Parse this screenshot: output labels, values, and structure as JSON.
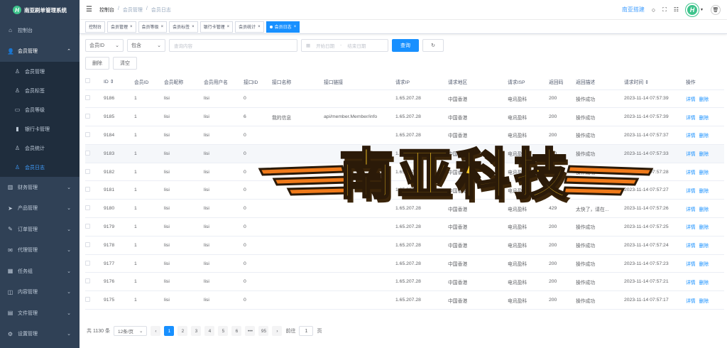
{
  "app": {
    "title": "南亚刷单管理系统"
  },
  "sidebar": {
    "items": [
      {
        "label": "控制台",
        "icon": "home-icon"
      },
      {
        "label": "会员管理",
        "icon": "user-icon"
      }
    ],
    "sub": [
      {
        "label": "会员管理",
        "icon": "user-icon"
      },
      {
        "label": "会员标签",
        "icon": "user-icon"
      },
      {
        "label": "会员等级",
        "icon": "card-icon"
      },
      {
        "label": "银行卡管理",
        "icon": "bank-icon"
      },
      {
        "label": "会员统计",
        "icon": "user-icon"
      },
      {
        "label": "会员日志",
        "icon": "user-icon"
      }
    ],
    "rest": [
      {
        "label": "财务管理",
        "icon": "chart-icon"
      },
      {
        "label": "产品管理",
        "icon": "send-icon"
      },
      {
        "label": "订单管理",
        "icon": "edit-icon"
      },
      {
        "label": "代理管理",
        "icon": "message-icon"
      },
      {
        "label": "任务组",
        "icon": "calendar-icon"
      },
      {
        "label": "内容管理",
        "icon": "content-icon"
      },
      {
        "label": "文件管理",
        "icon": "file-icon"
      },
      {
        "label": "设置管理",
        "icon": "gear-icon"
      }
    ]
  },
  "navbar": {
    "crumbs": [
      "控制台",
      "会员管理",
      "会员日志"
    ],
    "brand": "南亚搭建"
  },
  "tags": [
    "控制台",
    "会员管理",
    "会员等级",
    "会员标签",
    "银行卡管理",
    "会员统计",
    "会员日志"
  ],
  "filters": {
    "field": "会员ID",
    "op": "包含",
    "query_placeholder": "查询内容",
    "start_placeholder": "开始日期",
    "sep": "-",
    "end_placeholder": "结束日期",
    "search": "查询",
    "delete": "删除",
    "clear": "清空"
  },
  "columns": [
    "ID",
    "会员ID",
    "会员昵称",
    "会员用户名",
    "接口ID",
    "接口名称",
    "接口链接",
    "请求IP",
    "请求地区",
    "请求ISP",
    "返回码",
    "返回描述",
    "请求时间",
    "操作"
  ],
  "rows": [
    [
      "9186",
      "1",
      "lisi",
      "lisi",
      "0",
      "",
      "",
      "1.65.207.28",
      "中国香港",
      "电讯盈科",
      "200",
      "操作成功",
      "2023-11-14 07:57:39"
    ],
    [
      "9185",
      "1",
      "lisi",
      "lisi",
      "6",
      "我的信息",
      "api/member.Member/info",
      "1.65.207.28",
      "中国香港",
      "电讯盈科",
      "200",
      "操作成功",
      "2023-11-14 07:57:39"
    ],
    [
      "9184",
      "1",
      "lisi",
      "lisi",
      "0",
      "",
      "",
      "1.65.207.28",
      "中国香港",
      "电讯盈科",
      "200",
      "操作成功",
      "2023-11-14 07:57:37"
    ],
    [
      "9183",
      "1",
      "lisi",
      "lisi",
      "0",
      "",
      "",
      "1.65.207.28",
      "中国香港",
      "电讯盈科",
      "200",
      "操作成功",
      "2023-11-14 07:57:33"
    ],
    [
      "9182",
      "1",
      "lisi",
      "lisi",
      "0",
      "",
      "",
      "1.65.207.28",
      "中国香港",
      "电讯盈科",
      "200",
      "操作成功",
      "2023-11-14 07:57:28"
    ],
    [
      "9181",
      "1",
      "lisi",
      "lisi",
      "0",
      "",
      "",
      "1.65.207.28",
      "中国香港",
      "电讯盈科",
      "200",
      "操作成功",
      "2023-11-14 07:57:27"
    ],
    [
      "9180",
      "1",
      "lisi",
      "lisi",
      "0",
      "",
      "",
      "1.65.207.28",
      "中国香港",
      "电讯盈科",
      "429",
      "太快了，请在...",
      "2023-11-14 07:57:26"
    ],
    [
      "9179",
      "1",
      "lisi",
      "lisi",
      "0",
      "",
      "",
      "1.65.207.28",
      "中国香港",
      "电讯盈科",
      "200",
      "操作成功",
      "2023-11-14 07:57:25"
    ],
    [
      "9178",
      "1",
      "lisi",
      "lisi",
      "0",
      "",
      "",
      "1.65.207.28",
      "中国香港",
      "电讯盈科",
      "200",
      "操作成功",
      "2023-11-14 07:57:24"
    ],
    [
      "9177",
      "1",
      "lisi",
      "lisi",
      "0",
      "",
      "",
      "1.65.207.28",
      "中国香港",
      "电讯盈科",
      "200",
      "操作成功",
      "2023-11-14 07:57:23"
    ],
    [
      "9176",
      "1",
      "lisi",
      "lisi",
      "0",
      "",
      "",
      "1.65.207.28",
      "中国香港",
      "电讯盈科",
      "200",
      "操作成功",
      "2023-11-14 07:57:21"
    ],
    [
      "9175",
      "1",
      "lisi",
      "lisi",
      "0",
      "",
      "",
      "1.65.207.28",
      "中国香港",
      "电讯盈科",
      "200",
      "操作成功",
      "2023-11-14 07:57:17"
    ]
  ],
  "row_actions": {
    "detail": "详情",
    "delete": "删除"
  },
  "pagination": {
    "total": "共 1130 条",
    "page_size": "12条/页",
    "pages": [
      "1",
      "2",
      "3",
      "4",
      "5",
      "6",
      "•••",
      "95"
    ],
    "goto": "前往",
    "page": "1",
    "page_unit": "页"
  },
  "watermark": {
    "text": "南亚科技"
  },
  "colors": {
    "sidebar": "#304156",
    "primary": "#1890ff",
    "avatar": "#3ec48c"
  }
}
